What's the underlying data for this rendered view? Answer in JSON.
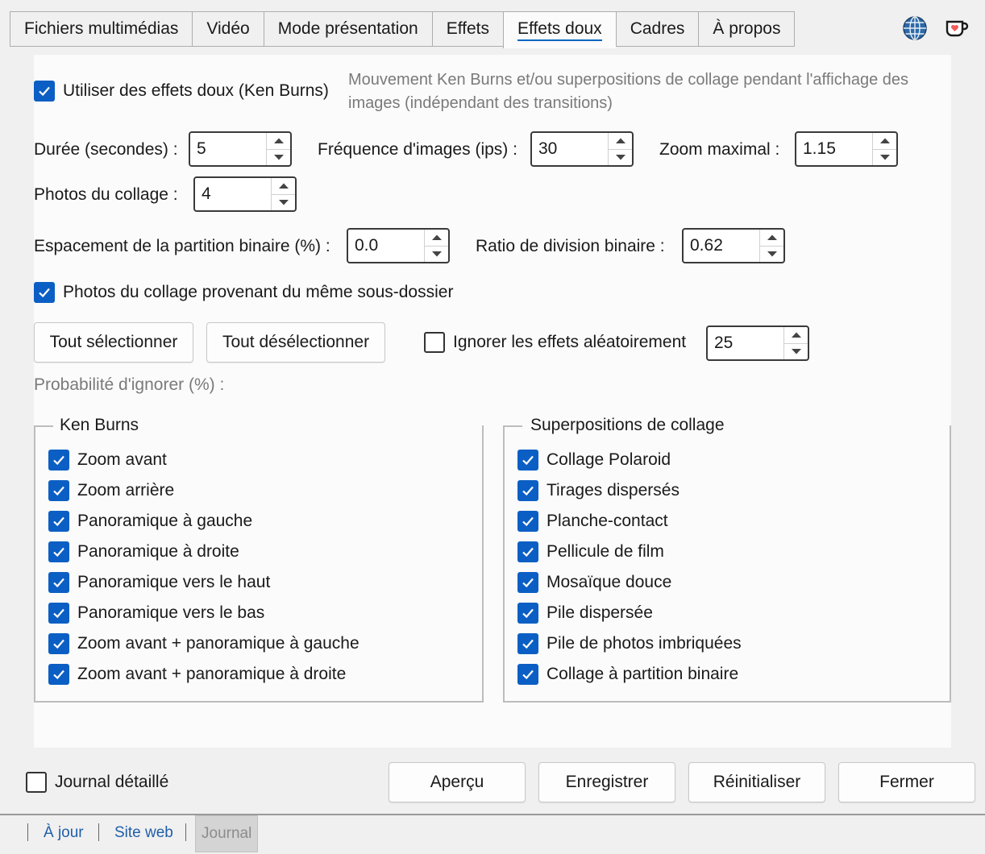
{
  "tabs": [
    {
      "label": "Fichiers multimédias",
      "active": false
    },
    {
      "label": "Vidéo",
      "active": false
    },
    {
      "label": "Mode présentation",
      "active": false
    },
    {
      "label": "Effets",
      "active": false
    },
    {
      "label": "Effets doux",
      "active": true
    },
    {
      "label": "Cadres",
      "active": false
    },
    {
      "label": "À propos",
      "active": false
    }
  ],
  "icons": {
    "globe": "globe-icon",
    "kofi": "kofi-cup-icon",
    "accent": "#0b5fc4"
  },
  "main": {
    "use_soft_effects_label": "Utiliser des effets doux (Ken Burns)",
    "use_soft_effects_checked": true,
    "description_line1": "Mouvement Ken Burns et/ou superpositions de collage pendant l'affichage des",
    "description_line2": "images (indépendant des transitions)",
    "duration_label": "Durée (secondes) :",
    "duration_value": "5",
    "fps_label": "Fréquence d'images (ips) :",
    "fps_value": "30",
    "max_zoom_label": "Zoom maximal :",
    "max_zoom_value": "1.15",
    "collage_photos_label": "Photos du collage :",
    "collage_photos_value": "4",
    "bsp_spacing_label": "Espacement de la partition binaire (%) :",
    "bsp_spacing_value": "0.0",
    "bsp_ratio_label": "Ratio de division binaire :",
    "bsp_ratio_value": "0.62",
    "same_subfolder_label": "Photos du collage provenant du même sous-dossier",
    "same_subfolder_checked": true,
    "select_all_label": "Tout sélectionner",
    "deselect_all_label": "Tout désélectionner",
    "skip_random_label": "Ignorer les effets aléatoirement",
    "skip_random_checked": false,
    "skip_probability_value": "25",
    "skip_probability_label": "Probabilité d'ignorer (%) :"
  },
  "ken_burns": {
    "title": "Ken Burns",
    "items": [
      {
        "label": "Zoom avant",
        "checked": true
      },
      {
        "label": "Zoom arrière",
        "checked": true
      },
      {
        "label": "Panoramique à gauche",
        "checked": true
      },
      {
        "label": "Panoramique à droite",
        "checked": true
      },
      {
        "label": "Panoramique vers le haut",
        "checked": true
      },
      {
        "label": "Panoramique vers le bas",
        "checked": true
      },
      {
        "label": "Zoom avant + panoramique à gauche",
        "checked": true
      },
      {
        "label": "Zoom avant + panoramique à droite",
        "checked": true
      }
    ]
  },
  "collage": {
    "title": "Superpositions de collage",
    "items": [
      {
        "label": "Collage Polaroid",
        "checked": true
      },
      {
        "label": "Tirages dispersés",
        "checked": true
      },
      {
        "label": "Planche-contact",
        "checked": true
      },
      {
        "label": "Pellicule de film",
        "checked": true
      },
      {
        "label": "Mosaïque douce",
        "checked": true
      },
      {
        "label": "Pile dispersée",
        "checked": true
      },
      {
        "label": "Pile de photos imbriquées",
        "checked": true
      },
      {
        "label": "Collage à partition binaire",
        "checked": true
      }
    ]
  },
  "footer": {
    "verbose_log_label": "Journal détaillé",
    "verbose_log_checked": false,
    "preview_label": "Aperçu",
    "save_label": "Enregistrer",
    "reset_label": "Réinitialiser",
    "close_label": "Fermer"
  },
  "statusbar": {
    "update_label": "À jour",
    "website_label": "Site web",
    "log_label": "Journal"
  }
}
